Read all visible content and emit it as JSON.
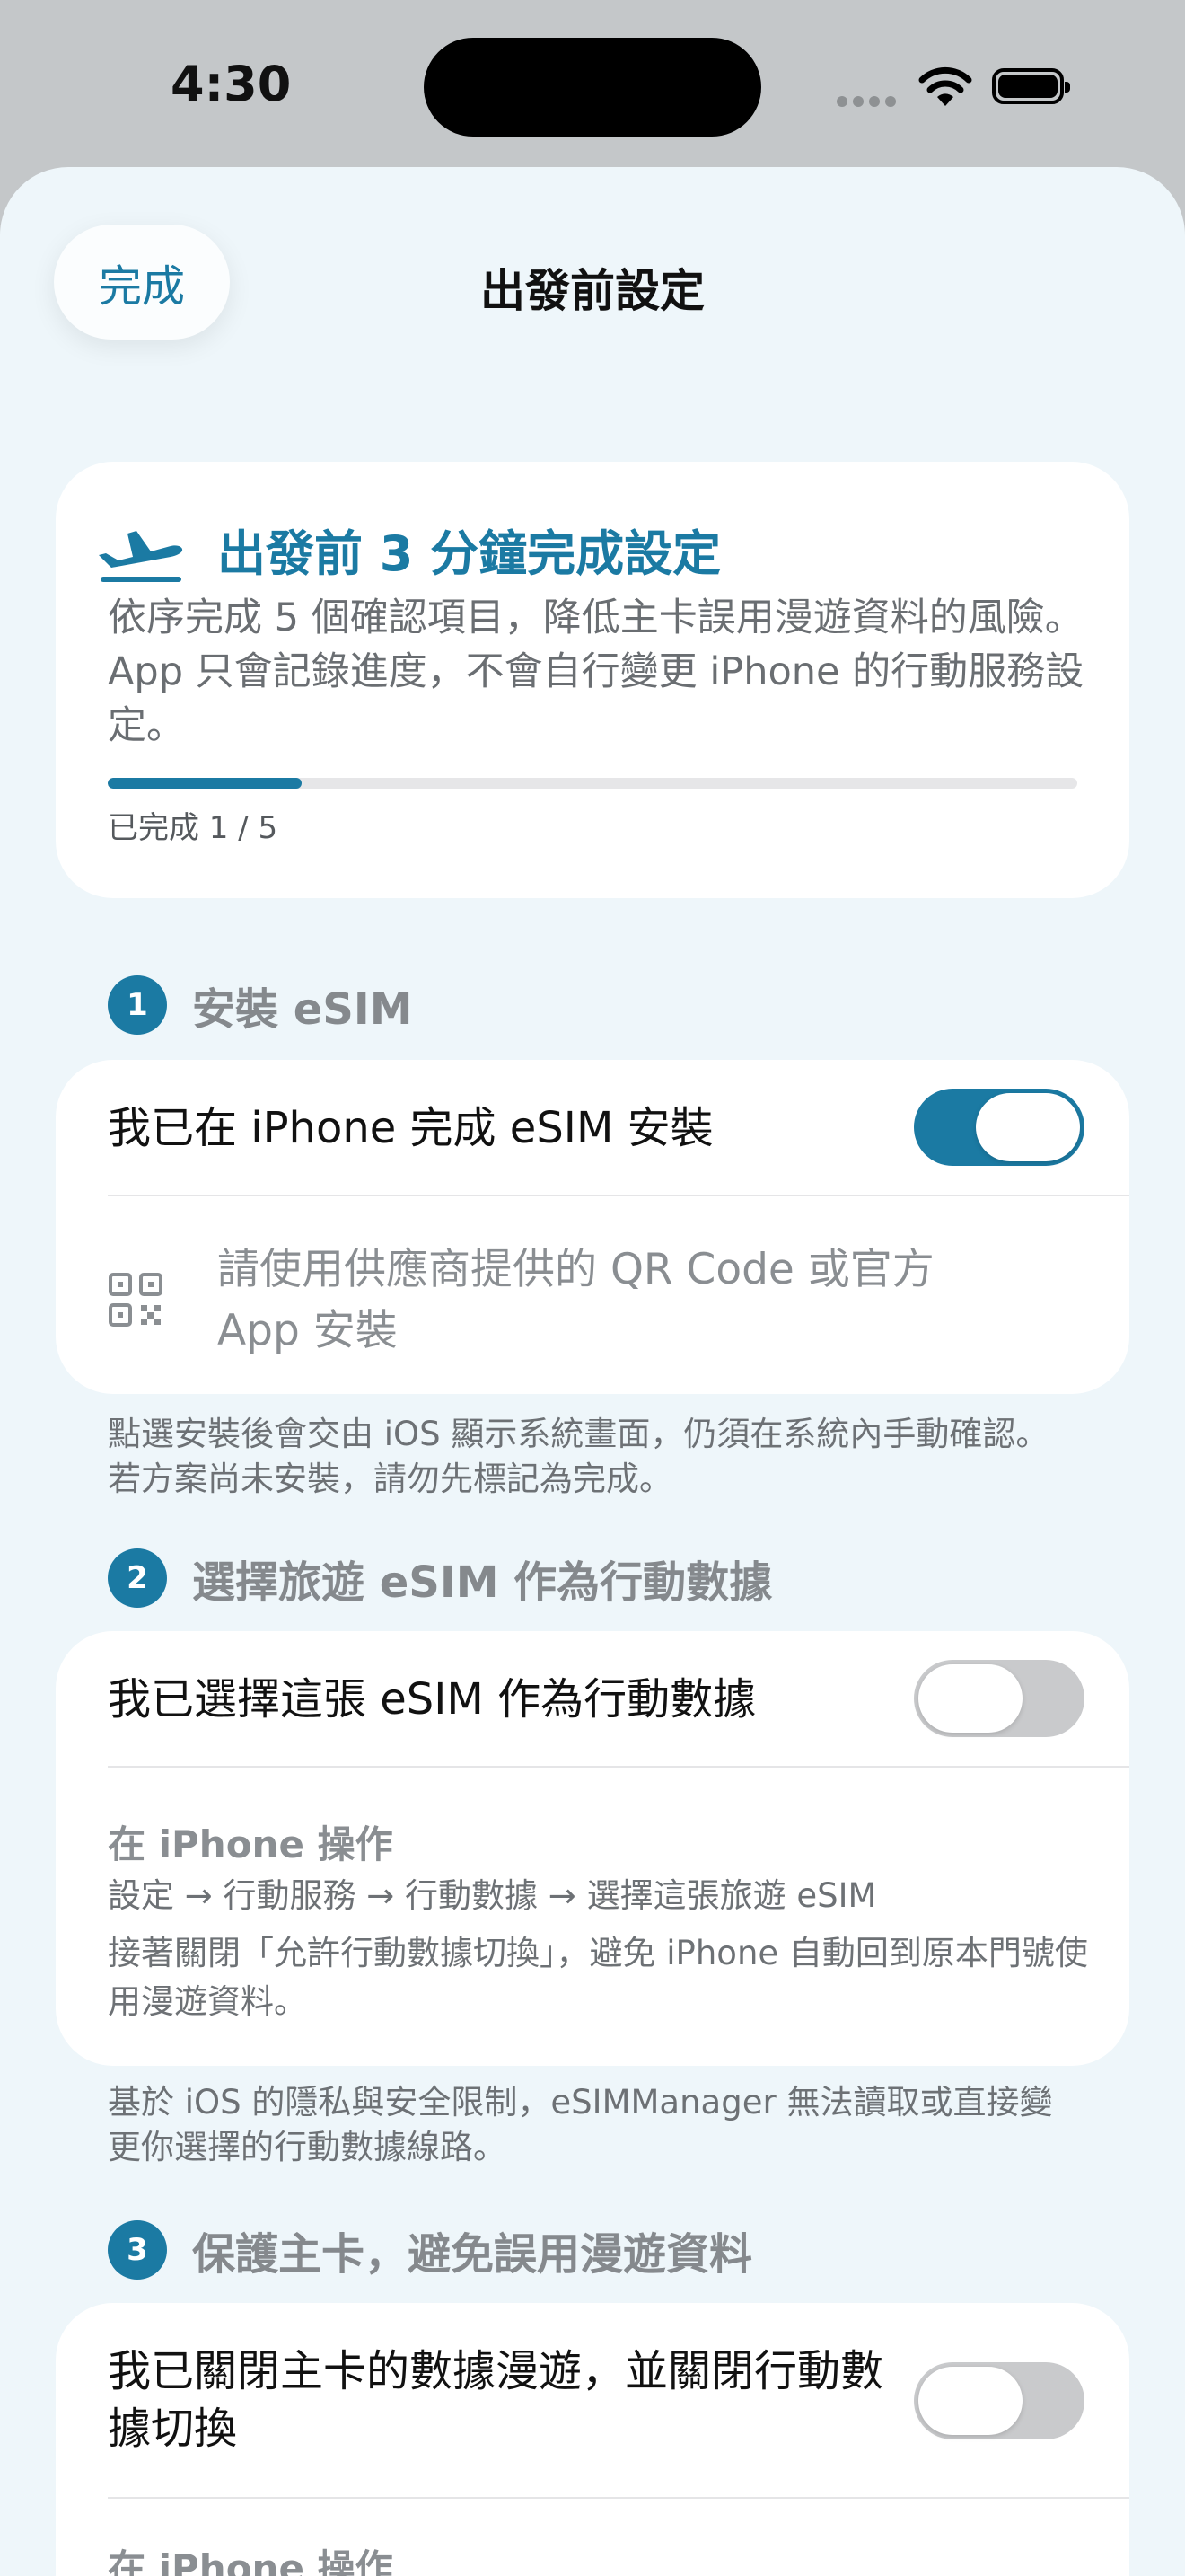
{
  "status_bar": {
    "time": "4:30"
  },
  "nav": {
    "done_label": "完成",
    "title": "出發前設定"
  },
  "hero": {
    "title": "出發前 3 分鐘完成設定",
    "description": "依序完成 5 個確認項目，降低主卡誤用漫遊資料的風險。App 只會記錄進度，不會自行變更 iPhone 的行動服務設定。",
    "progress_text": "已完成 1 / 5",
    "progress_fraction": 0.2
  },
  "sections": [
    {
      "number": "1",
      "title": "安裝 eSIM",
      "toggle_label": "我已在 iPhone 完成 eSIM 安裝",
      "toggle_on": true,
      "hint": "請使用供應商提供的 QR Code 或官方 App 安裝",
      "hint_icon": "qr-code-icon",
      "footnote": "點選安裝後會交由 iOS 顯示系統畫面，仍須在系統內手動確認。若方案尚未安裝，請勿先標記為完成。"
    },
    {
      "number": "2",
      "title": "選擇旅遊 eSIM 作為行動數據",
      "toggle_label": "我已選擇這張 eSIM 作為行動數據",
      "toggle_on": false,
      "instruction_heading": "在 iPhone 操作",
      "instruction_path": "設定 → 行動服務 → 行動數據 → 選擇這張旅遊 eSIM",
      "instruction_note": "接著關閉「允許行動數據切換」，避免 iPhone 自動回到原本門號使用漫遊資料。",
      "footnote": "基於 iOS 的隱私與安全限制，eSIMManager 無法讀取或直接變更你選擇的行動數據線路。"
    },
    {
      "number": "3",
      "title": "保護主卡，避免誤用漫遊資料",
      "toggle_label": "我已關閉主卡的數據漫遊，並關閉行動數據切換",
      "toggle_on": false,
      "instruction_heading": "在 iPhone 操作"
    }
  ],
  "colors": {
    "accent": "#1b7aa3",
    "background": "#eef6fa",
    "toggle_off": "#c9cacc"
  }
}
